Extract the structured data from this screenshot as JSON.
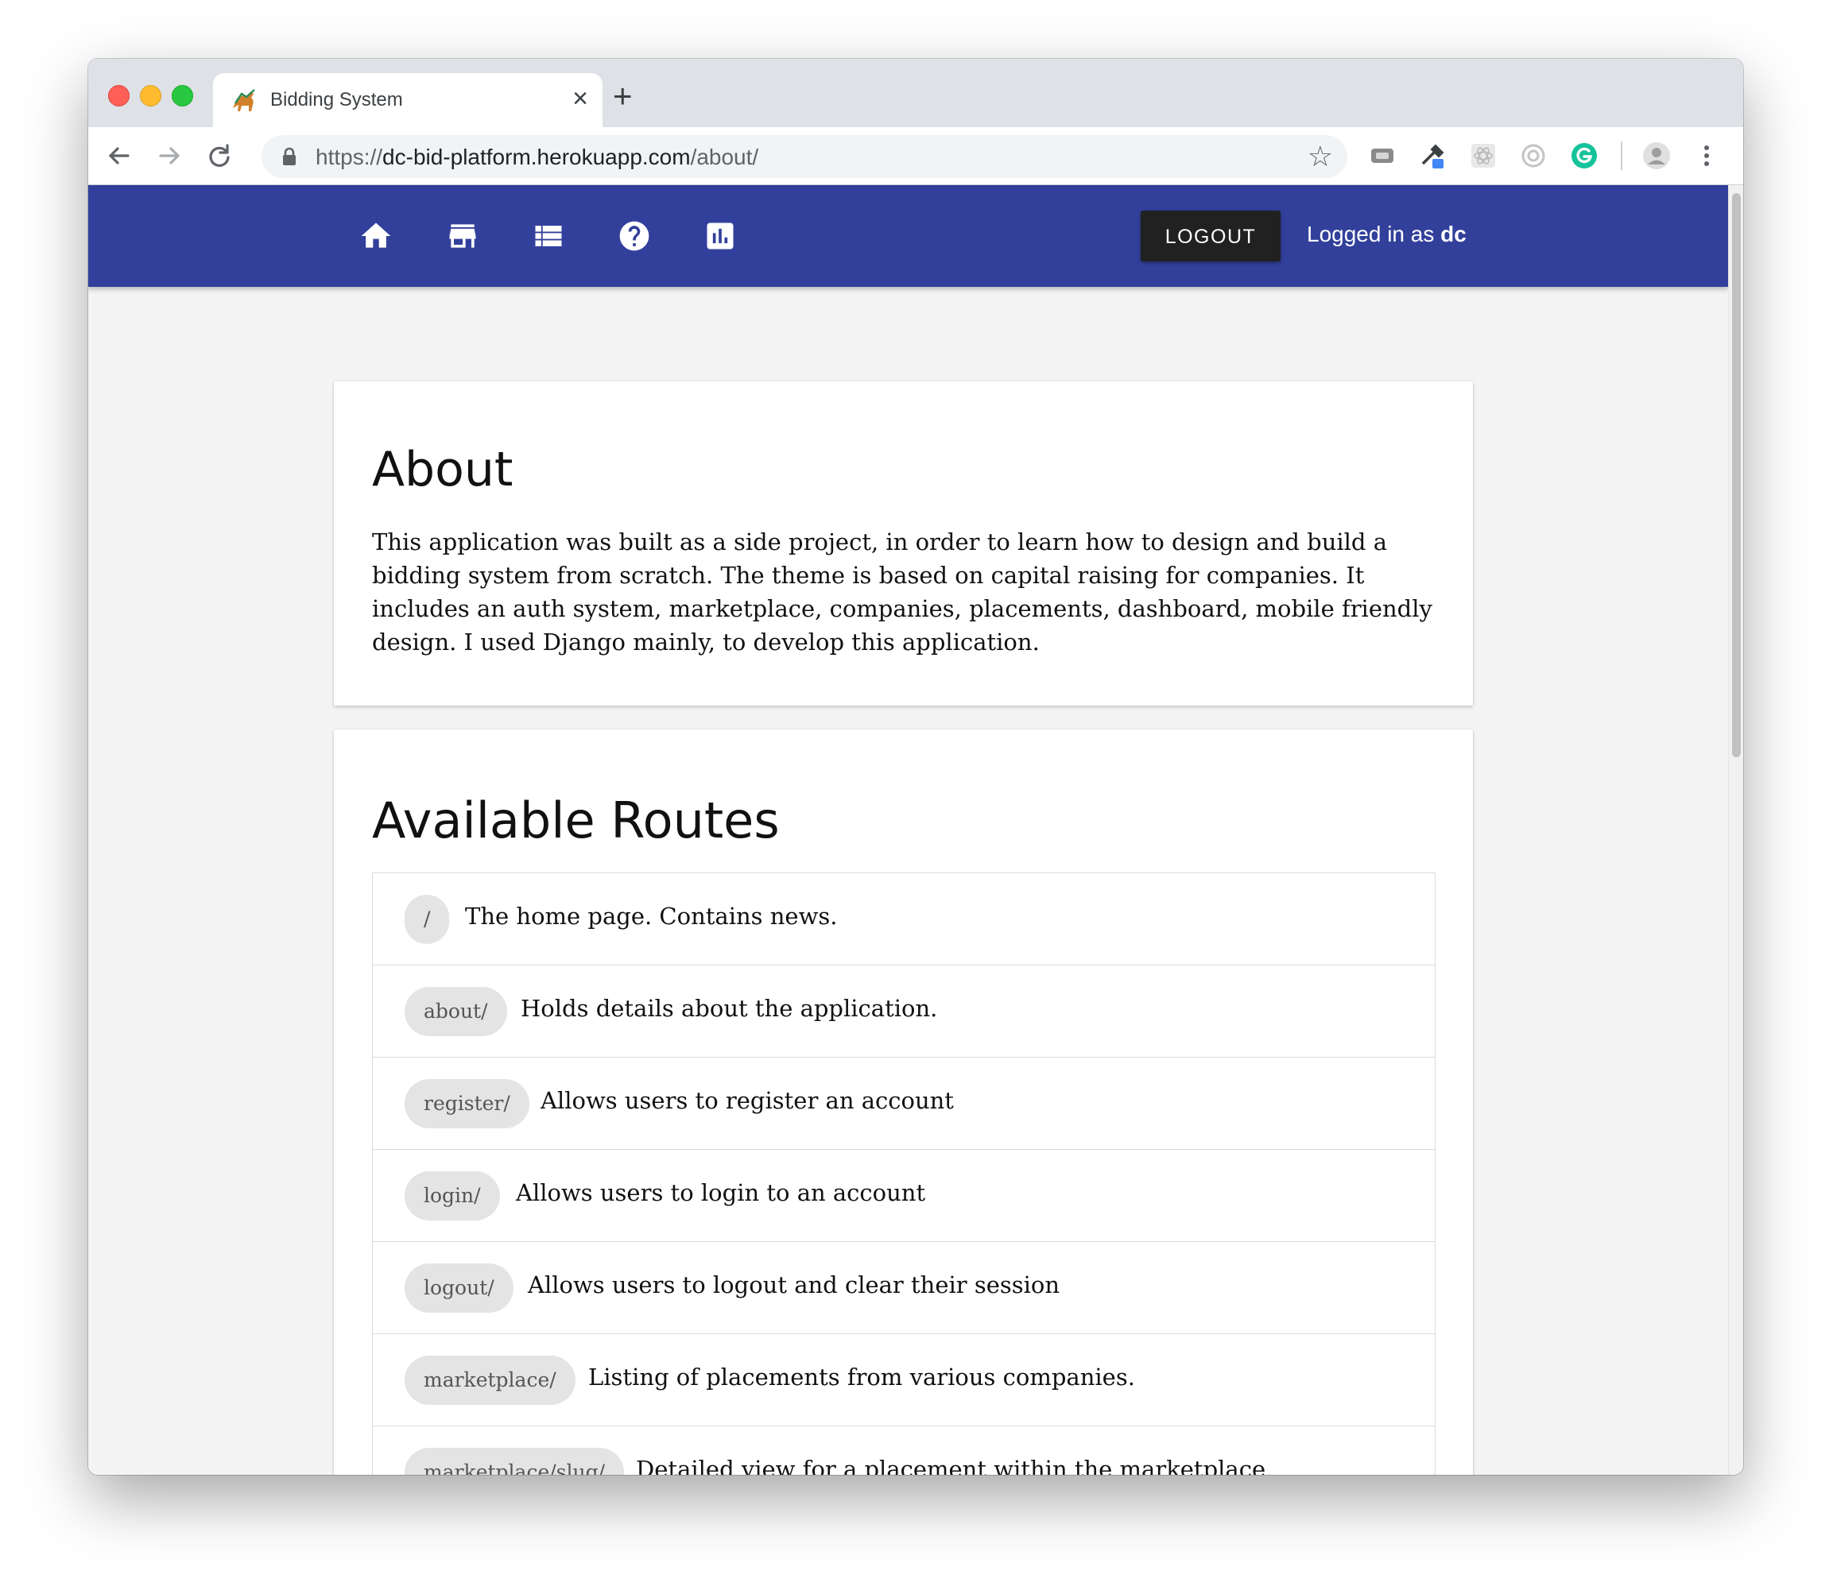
{
  "browser": {
    "tab_title": "Bidding System",
    "tab_close": "×",
    "new_tab": "+",
    "url_scheme": "https://",
    "url_host": "dc-bid-platform.herokuapp.com",
    "url_path": "/about/",
    "bookmark_star": "☆"
  },
  "nav": {
    "icons": [
      "home-icon",
      "store-icon",
      "list-icon",
      "help-icon",
      "chart-icon"
    ],
    "logout_label": "LOGOUT",
    "logged_in_prefix": "Logged in as",
    "username": "dc",
    "bar_color": "#32409b"
  },
  "about": {
    "title": "About",
    "text": "This application was built as a side project, in order to learn how to design and build a bidding system from scratch. The theme is based on capital raising for companies. It includes an auth system, marketplace, companies, placements, dashboard, mobile friendly design. I used Django mainly, to develop this application."
  },
  "routes": {
    "title": "Available Routes",
    "items": [
      {
        "path": "/",
        "description": "The home page. Contains news."
      },
      {
        "path": "about/",
        "description": "Holds details about the application."
      },
      {
        "path": "register/",
        "description": "Allows users to register an account"
      },
      {
        "path": "login/",
        "description": "Allows users to login to an account"
      },
      {
        "path": "logout/",
        "description": "Allows users to logout and clear their session"
      },
      {
        "path": "marketplace/",
        "description": "Listing of placements from various companies."
      },
      {
        "path": "marketplace/slug/",
        "description": "Detailed view for a placement within the marketplace."
      }
    ]
  }
}
